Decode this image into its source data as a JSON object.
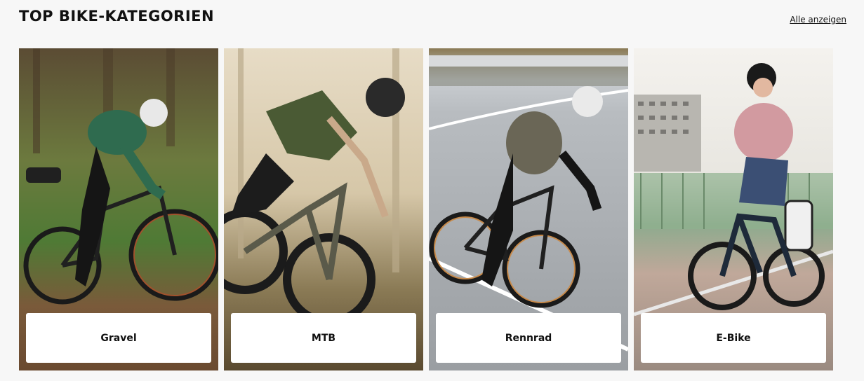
{
  "section": {
    "title": "TOP BIKE-KATEGORIEN",
    "see_all_label": "Alle anzeigen"
  },
  "categories": [
    {
      "label": "Gravel",
      "image": "gravel-rider-photo"
    },
    {
      "label": "MTB",
      "image": "mtb-rider-photo"
    },
    {
      "label": "Rennrad",
      "image": "road-bike-rider-photo"
    },
    {
      "label": "E-Bike",
      "image": "e-bike-rider-photo"
    }
  ]
}
